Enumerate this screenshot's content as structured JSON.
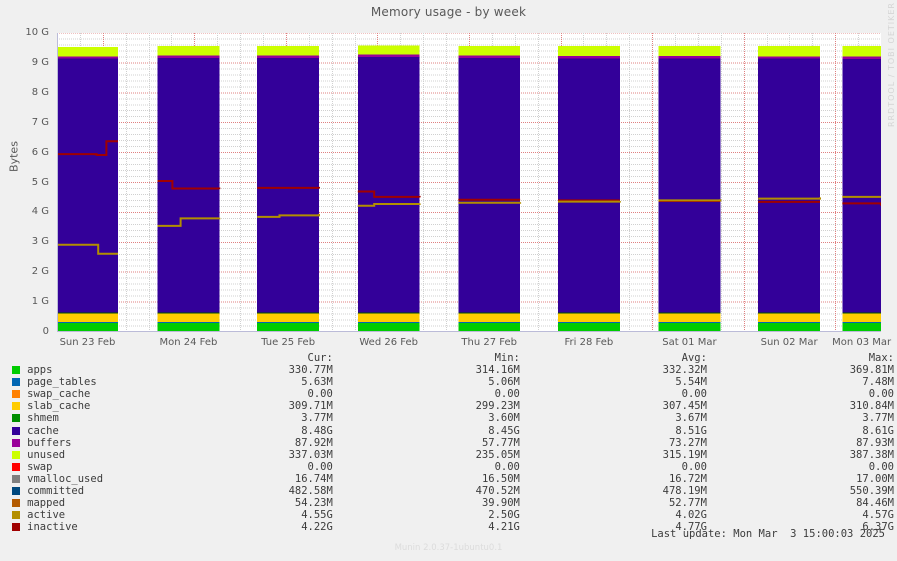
{
  "title": "Memory usage - by week",
  "watermark": "RRDTOOL / TOBI OETIKER",
  "ylabel": "Bytes",
  "version": "Munin 2.0.37-1ubuntu0.1",
  "last_update": "Last update: Mon Mar  3 15:00:03 2025",
  "axes": {
    "ylim": [
      0,
      10000000000
    ],
    "yticks": [
      "0",
      "1 G",
      "2 G",
      "3 G",
      "4 G",
      "5 G",
      "6 G",
      "7 G",
      "8 G",
      "9 G",
      "10 G"
    ],
    "xticks": [
      "Sun 23 Feb",
      "Mon 24 Feb",
      "Tue 25 Feb",
      "Wed 26 Feb",
      "Thu 27 Feb",
      "Fri 28 Feb",
      "Sat 01 Mar",
      "Sun 02 Mar",
      "Mon 03 Mar"
    ]
  },
  "legend": {
    "headers": {
      "cur": "Cur:",
      "min": "Min:",
      "avg": "Avg:",
      "max": "Max:"
    },
    "rows": [
      {
        "name": "apps",
        "color": "#00cc00",
        "cur": "330.77M",
        "min": "314.16M",
        "avg": "332.32M",
        "max": "369.81M"
      },
      {
        "name": "page_tables",
        "color": "#0066b3",
        "cur": "5.63M",
        "min": "5.06M",
        "avg": "5.54M",
        "max": "7.48M"
      },
      {
        "name": "swap_cache",
        "color": "#ff8000",
        "cur": "0.00",
        "min": "0.00",
        "avg": "0.00",
        "max": "0.00"
      },
      {
        "name": "slab_cache",
        "color": "#ffcc00",
        "cur": "309.71M",
        "min": "299.23M",
        "avg": "307.45M",
        "max": "310.84M"
      },
      {
        "name": "shmem",
        "color": "#330099",
        "cur": "3.77M",
        "min": "3.60M",
        "avg": "3.67M",
        "max": "3.77M"
      },
      {
        "name": "cache",
        "color": "#990099",
        "cur": "8.48G",
        "min": "8.45G",
        "avg": "8.51G",
        "max": "8.61G"
      },
      {
        "name": "buffers",
        "color": "#ccff00",
        "cur": "87.92M",
        "min": "57.77M",
        "avg": "73.27M",
        "max": "87.93M"
      },
      {
        "name": "unused",
        "color": "#ff0000",
        "cur": "337.03M",
        "min": "235.05M",
        "avg": "315.19M",
        "max": "387.38M"
      },
      {
        "name": "swap",
        "color": "#808080",
        "cur": "0.00",
        "min": "0.00",
        "avg": "0.00",
        "max": "0.00"
      },
      {
        "name": "vmalloc_used",
        "color": "#008f00",
        "cur": "16.74M",
        "min": "16.50M",
        "avg": "16.72M",
        "max": "17.00M"
      },
      {
        "name": "committed",
        "color": "#00487d",
        "cur": "482.58M",
        "min": "470.52M",
        "avg": "478.19M",
        "max": "550.39M"
      },
      {
        "name": "mapped",
        "color": "#b35a00",
        "cur": "54.23M",
        "min": "39.90M",
        "avg": "52.77M",
        "max": "84.46M"
      },
      {
        "name": "active",
        "color": "#b38f00",
        "cur": "4.55G",
        "min": "2.50G",
        "avg": "4.02G",
        "max": "4.57G"
      },
      {
        "name": "inactive",
        "color": "#a00000",
        "cur": "4.22G",
        "min": "4.21G",
        "avg": "4.77G",
        "max": "6.37G"
      }
    ],
    "swatch_colors": [
      "#00cc00",
      "#0066b3",
      "#ff8000",
      "#ffcc00",
      "#008f00",
      "#330099",
      "#990099",
      "#ccff00",
      "#ff0000",
      "#808080",
      "#00487d",
      "#b35a00",
      "#b38f00",
      "#a00000"
    ]
  },
  "chart_data": {
    "type": "area",
    "title": "Memory usage - by week",
    "xlabel": "",
    "ylabel": "Bytes",
    "ylim": [
      0,
      10000000000
    ],
    "grid": true,
    "legend_position": "below",
    "categories": [
      "Sun 23 Feb",
      "Mon 24 Feb",
      "Tue 25 Feb",
      "Wed 26 Feb",
      "Thu 27 Feb",
      "Fri 28 Feb",
      "Sat 01 Mar",
      "Sun 02 Mar",
      "Mon 03 Mar"
    ],
    "note": "Stacked area chart with 9 data segments separated by gaps (missing data). Values in bytes (G = 1e9).",
    "stack_order": [
      "apps",
      "page_tables",
      "swap_cache",
      "slab_cache",
      "shmem",
      "cache",
      "buffers",
      "unused"
    ],
    "segments": [
      {
        "day": "Sun 23 Feb",
        "x0": 0.0,
        "x1": 0.074,
        "apps": 0.33,
        "page_tables": 0.006,
        "swap_cache": 0,
        "slab_cache": 0.31,
        "shmem": 0.004,
        "cache": 8.5,
        "buffers": 0.06,
        "unused": 0.33
      },
      {
        "day": "Mon 24 Feb",
        "x0": 0.122,
        "x1": 0.197,
        "apps": 0.33,
        "page_tables": 0.006,
        "swap_cache": 0,
        "slab_cache": 0.31,
        "shmem": 0.004,
        "cache": 8.52,
        "buffers": 0.07,
        "unused": 0.33
      },
      {
        "day": "Tue 25 Feb",
        "x0": 0.243,
        "x1": 0.318,
        "apps": 0.33,
        "page_tables": 0.006,
        "swap_cache": 0,
        "slab_cache": 0.31,
        "shmem": 0.004,
        "cache": 8.52,
        "buffers": 0.07,
        "unused": 0.33
      },
      {
        "day": "Wed 26 Feb",
        "x0": 0.365,
        "x1": 0.44,
        "apps": 0.33,
        "page_tables": 0.006,
        "swap_cache": 0,
        "slab_cache": 0.31,
        "shmem": 0.004,
        "cache": 8.55,
        "buffers": 0.08,
        "unused": 0.3
      },
      {
        "day": "Thu 27 Feb",
        "x0": 0.487,
        "x1": 0.562,
        "apps": 0.33,
        "page_tables": 0.006,
        "swap_cache": 0,
        "slab_cache": 0.31,
        "shmem": 0.004,
        "cache": 8.52,
        "buffers": 0.08,
        "unused": 0.31
      },
      {
        "day": "Fri 28 Feb",
        "x0": 0.608,
        "x1": 0.683,
        "apps": 0.33,
        "page_tables": 0.006,
        "swap_cache": 0,
        "slab_cache": 0.31,
        "shmem": 0.004,
        "cache": 8.5,
        "buffers": 0.08,
        "unused": 0.33
      },
      {
        "day": "Sat 01 Mar",
        "x0": 0.73,
        "x1": 0.805,
        "apps": 0.33,
        "page_tables": 0.006,
        "swap_cache": 0,
        "slab_cache": 0.31,
        "shmem": 0.004,
        "cache": 8.5,
        "buffers": 0.08,
        "unused": 0.33
      },
      {
        "day": "Sun 02 Mar",
        "x0": 0.851,
        "x1": 0.926,
        "apps": 0.33,
        "page_tables": 0.006,
        "swap_cache": 0,
        "slab_cache": 0.31,
        "shmem": 0.004,
        "cache": 8.49,
        "buffers": 0.08,
        "unused": 0.34
      },
      {
        "day": "Mon 03 Mar",
        "x0": 0.953,
        "x1": 1.0,
        "apps": 0.33,
        "page_tables": 0.006,
        "swap_cache": 0,
        "slab_cache": 0.31,
        "shmem": 0.004,
        "cache": 8.48,
        "buffers": 0.09,
        "unused": 0.34
      }
    ],
    "overlay_lines": [
      {
        "name": "inactive",
        "color": "#a00000",
        "points": [
          [
            0.0,
            5.95
          ],
          [
            0.03,
            5.95
          ],
          [
            0.048,
            5.92
          ],
          [
            0.06,
            6.38
          ],
          [
            0.074,
            6.38
          ],
          [
            0.122,
            5.05
          ],
          [
            0.133,
            5.05
          ],
          [
            0.14,
            4.8
          ],
          [
            0.197,
            4.78
          ],
          [
            0.243,
            4.82
          ],
          [
            0.318,
            4.8
          ],
          [
            0.365,
            4.7
          ],
          [
            0.385,
            4.52
          ],
          [
            0.44,
            4.5
          ],
          [
            0.487,
            4.42
          ],
          [
            0.562,
            4.42
          ],
          [
            0.608,
            4.4
          ],
          [
            0.683,
            4.4
          ],
          [
            0.73,
            4.38
          ],
          [
            0.805,
            4.38
          ],
          [
            0.851,
            4.35
          ],
          [
            0.926,
            4.35
          ],
          [
            0.953,
            4.3
          ],
          [
            1.0,
            4.22
          ]
        ]
      },
      {
        "name": "active",
        "color": "#b38f00",
        "points": [
          [
            0.0,
            2.92
          ],
          [
            0.04,
            2.92
          ],
          [
            0.05,
            2.62
          ],
          [
            0.074,
            2.62
          ],
          [
            0.122,
            3.55
          ],
          [
            0.15,
            3.8
          ],
          [
            0.197,
            3.82
          ],
          [
            0.243,
            3.85
          ],
          [
            0.27,
            3.9
          ],
          [
            0.318,
            3.95
          ],
          [
            0.365,
            4.22
          ],
          [
            0.385,
            4.28
          ],
          [
            0.44,
            4.3
          ],
          [
            0.487,
            4.32
          ],
          [
            0.562,
            4.34
          ],
          [
            0.608,
            4.36
          ],
          [
            0.683,
            4.38
          ],
          [
            0.73,
            4.4
          ],
          [
            0.805,
            4.44
          ],
          [
            0.851,
            4.46
          ],
          [
            0.926,
            4.5
          ],
          [
            0.953,
            4.52
          ],
          [
            1.0,
            4.55
          ]
        ]
      }
    ]
  }
}
